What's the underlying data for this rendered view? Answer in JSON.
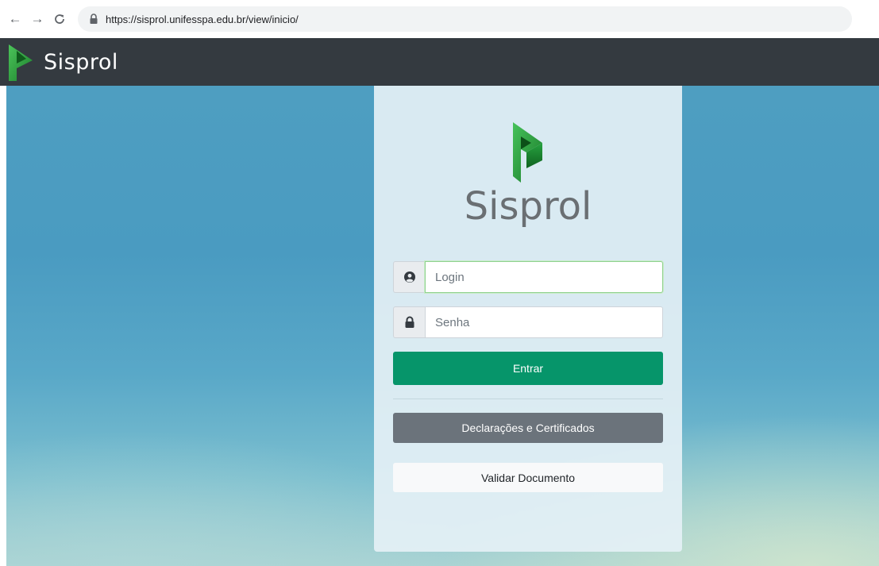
{
  "browser": {
    "url": "https://sisprol.unifesspa.edu.br/view/inicio/",
    "back_icon": "←",
    "forward_icon": "→",
    "reload_icon": "C"
  },
  "header": {
    "brand": "Sisprol"
  },
  "card": {
    "logo_text": "Sisprol",
    "login": {
      "placeholder": "Login",
      "icon": "user-circle-icon"
    },
    "password": {
      "placeholder": "Senha",
      "icon": "lock-icon"
    },
    "submit_label": "Entrar",
    "declarations_label": "Declarações e Certificados",
    "validate_label": "Validar Documento"
  },
  "colors": {
    "header_bg": "#343a40",
    "primary": "#06956a",
    "secondary": "#6b737b",
    "logo_green": "#1e9e3e"
  }
}
